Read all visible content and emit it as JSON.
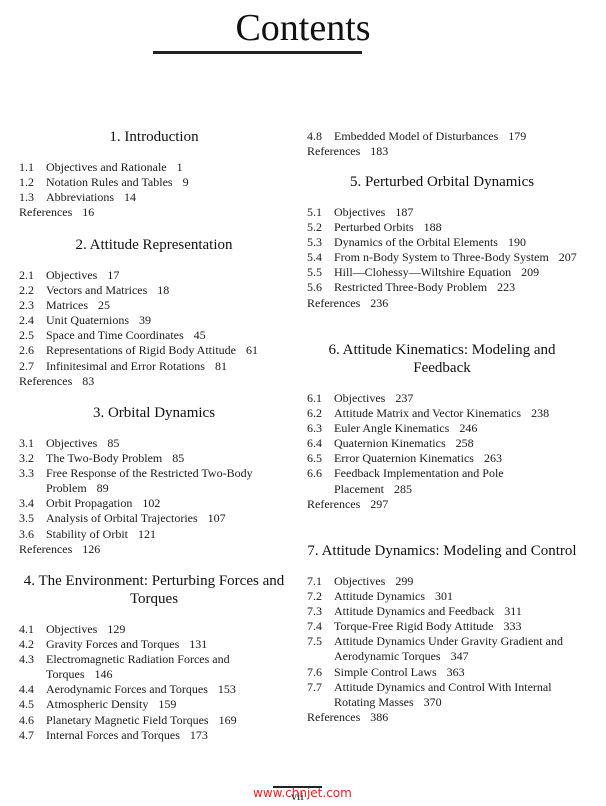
{
  "page": {
    "title": "Contents",
    "page_number": "vii",
    "watermark": "www.chnjet.com"
  },
  "left_column": {
    "chapter1": {
      "heading": "1.  Introduction",
      "entries": [
        {
          "num": "1.1",
          "text": "Objectives and Rationale",
          "page": "1"
        },
        {
          "num": "1.2",
          "text": "Notation Rules and Tables",
          "page": "9"
        },
        {
          "num": "1.3",
          "text": "Abbreviations",
          "page": "14"
        }
      ],
      "references": {
        "label": "References",
        "page": "16"
      }
    },
    "chapter2": {
      "heading": "2.  Attitude Representation",
      "entries": [
        {
          "num": "2.1",
          "text": "Objectives",
          "page": "17"
        },
        {
          "num": "2.2",
          "text": "Vectors and Matrices",
          "page": "18"
        },
        {
          "num": "2.3",
          "text": "Matrices",
          "page": "25"
        },
        {
          "num": "2.4",
          "text": "Unit Quaternions",
          "page": "39"
        },
        {
          "num": "2.5",
          "text": "Space and Time Coordinates",
          "page": "45"
        },
        {
          "num": "2.6",
          "text": "Representations of Rigid Body Attitude",
          "page": "61"
        },
        {
          "num": "2.7",
          "text": "Infinitesimal and Error Rotations",
          "page": "81"
        }
      ],
      "references": {
        "label": "References",
        "page": "83"
      }
    },
    "chapter3": {
      "heading": "3.  Orbital Dynamics",
      "entries": [
        {
          "num": "3.1",
          "text": "Objectives",
          "page": "85"
        },
        {
          "num": "3.2",
          "text": "The Two-Body Problem",
          "page": "85"
        },
        {
          "num": "3.3",
          "text": "Free Response of the Restricted Two-Body Problem",
          "page": "89"
        },
        {
          "num": "3.4",
          "text": "Orbit Propagation",
          "page": "102"
        },
        {
          "num": "3.5",
          "text": "Analysis of Orbital Trajectories",
          "page": "107"
        },
        {
          "num": "3.6",
          "text": "Stability of Orbit",
          "page": "121"
        }
      ],
      "references": {
        "label": "References",
        "page": "126"
      }
    },
    "chapter4": {
      "heading": "4.  The Environment: Perturbing Forces and Torques",
      "entries": [
        {
          "num": "4.1",
          "text": "Objectives",
          "page": "129"
        },
        {
          "num": "4.2",
          "text": "Gravity Forces and Torques",
          "page": "131"
        },
        {
          "num": "4.3",
          "text": "Electromagnetic Radiation Forces and Torques",
          "page": "146"
        },
        {
          "num": "4.4",
          "text": "Aerodynamic Forces and Torques",
          "page": "153"
        },
        {
          "num": "4.5",
          "text": "Atmospheric Density",
          "page": "159"
        },
        {
          "num": "4.6",
          "text": "Planetary Magnetic Field Torques",
          "page": "169"
        },
        {
          "num": "4.7",
          "text": "Internal Forces and Torques",
          "page": "173"
        }
      ]
    }
  },
  "right_column": {
    "chapter4_cont": {
      "entries": [
        {
          "num": "4.8",
          "text": "Embedded Model of Disturbances",
          "page": "179"
        }
      ],
      "references": {
        "label": "References",
        "page": "183"
      }
    },
    "chapter5": {
      "heading": "5.  Perturbed Orbital Dynamics",
      "entries": [
        {
          "num": "5.1",
          "text": "Objectives",
          "page": "187"
        },
        {
          "num": "5.2",
          "text": "Perturbed Orbits",
          "page": "188"
        },
        {
          "num": "5.3",
          "text": "Dynamics of the Orbital Elements",
          "page": "190"
        },
        {
          "num": "5.4",
          "text": "From n-Body System to Three-Body System",
          "page": "207"
        },
        {
          "num": "5.5",
          "text": "Hill—Clohessy—Wiltshire Equation",
          "page": "209"
        },
        {
          "num": "5.6",
          "text": "Restricted Three-Body Problem",
          "page": "223"
        }
      ],
      "references": {
        "label": "References",
        "page": "236"
      }
    },
    "chapter6": {
      "heading": "6.  Attitude Kinematics: Modeling and Feedback",
      "entries": [
        {
          "num": "6.1",
          "text": "Objectives",
          "page": "237"
        },
        {
          "num": "6.2",
          "text": "Attitude Matrix and Vector Kinematics",
          "page": "238"
        },
        {
          "num": "6.3",
          "text": "Euler Angle Kinematics",
          "page": "246"
        },
        {
          "num": "6.4",
          "text": "Quaternion Kinematics",
          "page": "258"
        },
        {
          "num": "6.5",
          "text": "Error Quaternion Kinematics",
          "page": "263"
        },
        {
          "num": "6.6",
          "text": "Feedback Implementation and Pole Placement",
          "page": "285"
        }
      ],
      "references": {
        "label": "References",
        "page": "297"
      }
    },
    "chapter7": {
      "heading": "7.  Attitude Dynamics: Modeling and Control",
      "entries": [
        {
          "num": "7.1",
          "text": "Objectives",
          "page": "299"
        },
        {
          "num": "7.2",
          "text": "Attitude Dynamics",
          "page": "301"
        },
        {
          "num": "7.3",
          "text": "Attitude Dynamics and Feedback",
          "page": "311"
        },
        {
          "num": "7.4",
          "text": "Torque-Free Rigid Body Attitude",
          "page": "333"
        },
        {
          "num": "7.5",
          "text": "Attitude Dynamics Under Gravity Gradient and Aerodynamic Torques",
          "page": "347"
        },
        {
          "num": "7.6",
          "text": "Simple Control Laws",
          "page": "363"
        },
        {
          "num": "7.7",
          "text": "Attitude Dynamics and Control With Internal Rotating Masses",
          "page": "370"
        }
      ],
      "references": {
        "label": "References",
        "page": "386"
      }
    }
  }
}
